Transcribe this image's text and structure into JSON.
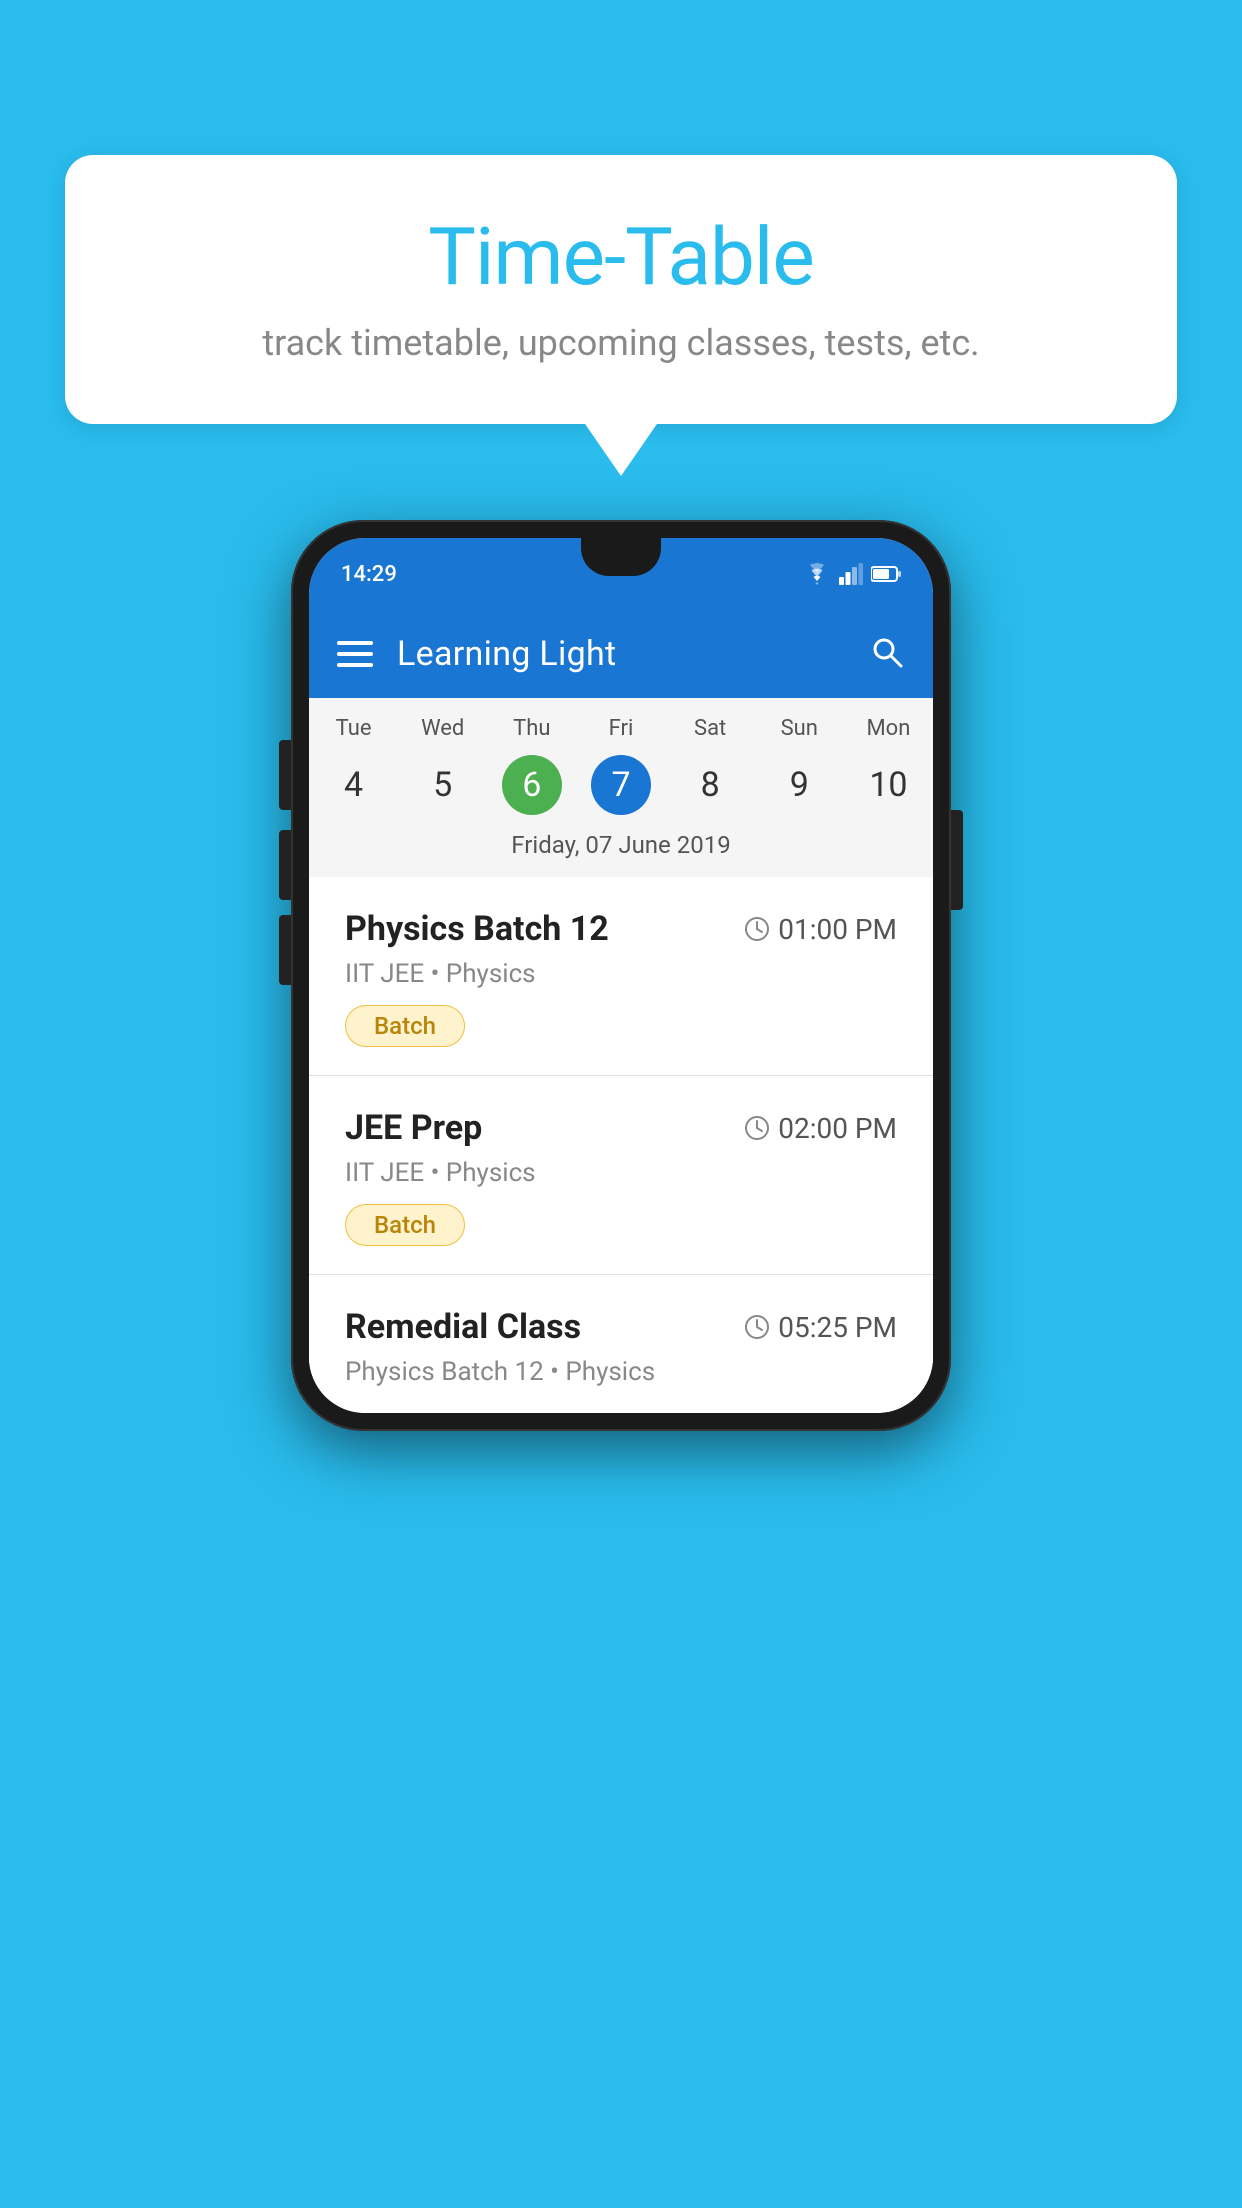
{
  "background_color": "#29BCED",
  "speech_bubble": {
    "title": "Time-Table",
    "subtitle": "track timetable, upcoming classes, tests, etc."
  },
  "phone": {
    "status_bar": {
      "time": "14:29"
    },
    "app_bar": {
      "title": "Learning Light"
    },
    "calendar": {
      "days_of_week": [
        "Tue",
        "Wed",
        "Thu",
        "Fri",
        "Sat",
        "Sun",
        "Mon"
      ],
      "day_numbers": [
        "4",
        "5",
        "6",
        "7",
        "8",
        "9",
        "10"
      ],
      "today_index": 2,
      "selected_index": 3,
      "selected_date_label": "Friday, 07 June 2019"
    },
    "schedule": [
      {
        "title": "Physics Batch 12",
        "time": "01:00 PM",
        "subtitle": "IIT JEE • Physics",
        "badge": "Batch"
      },
      {
        "title": "JEE Prep",
        "time": "02:00 PM",
        "subtitle": "IIT JEE • Physics",
        "badge": "Batch"
      },
      {
        "title": "Remedial Class",
        "time": "05:25 PM",
        "subtitle": "Physics Batch 12 • Physics",
        "badge": null
      }
    ]
  }
}
